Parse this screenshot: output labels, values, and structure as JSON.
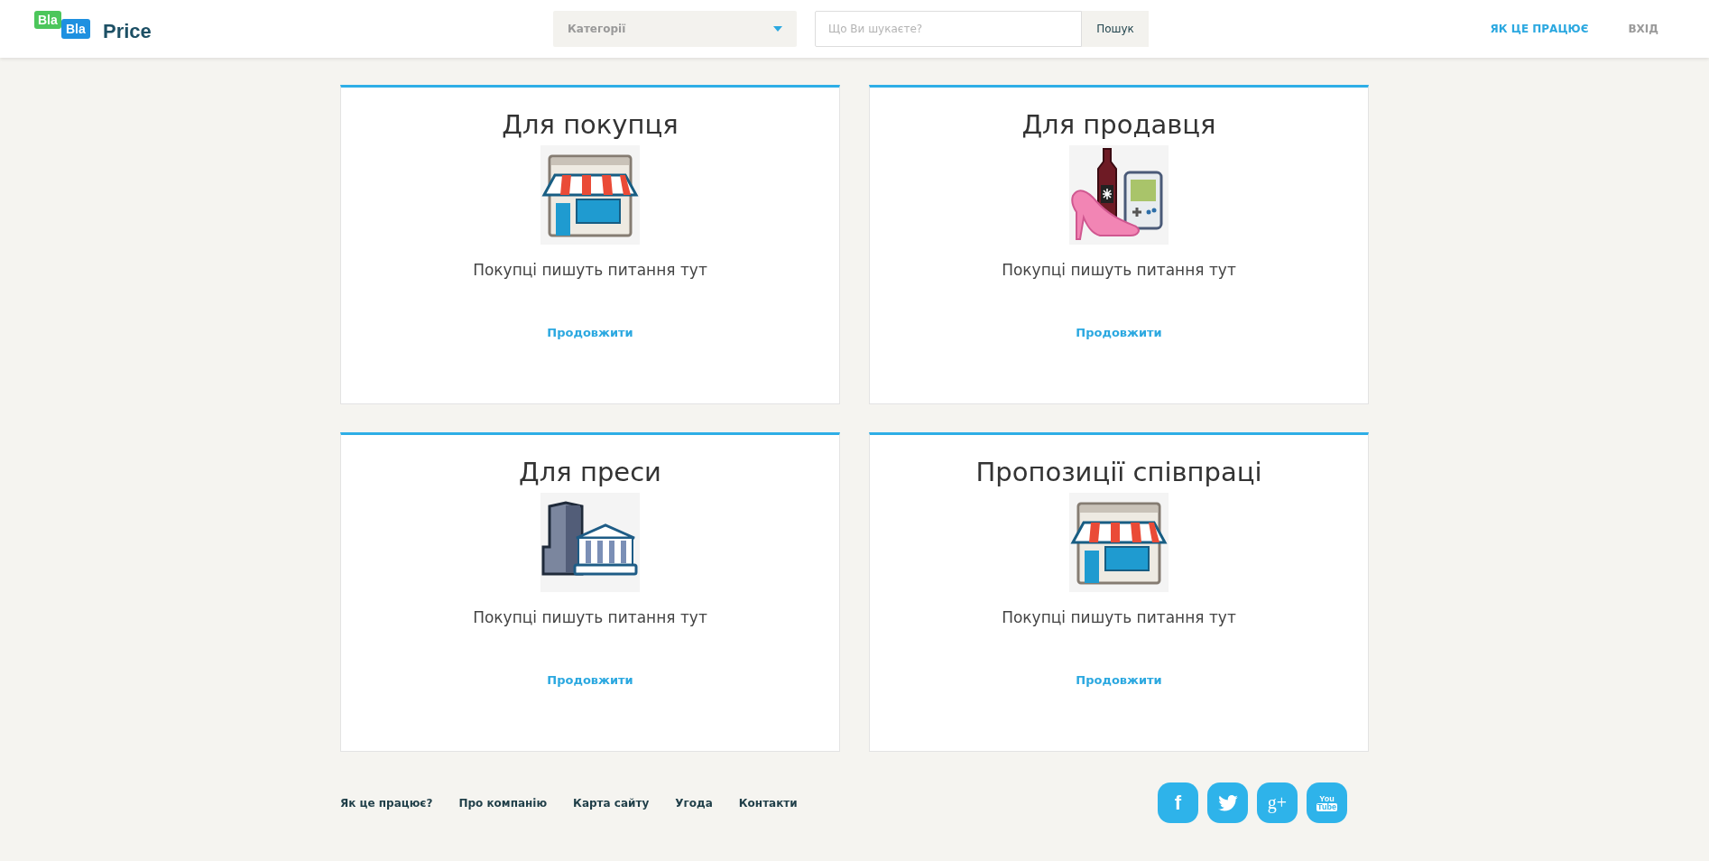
{
  "header": {
    "logo": {
      "word_1": "Bla",
      "word_2": "Bla",
      "word_3": "Price"
    },
    "category_select": {
      "placeholder": "Категорії"
    },
    "search": {
      "placeholder": "Що Ви шукаєте?",
      "button": "Пошук"
    },
    "nav": [
      {
        "label": "ЯК ЦЕ ПРАЦЮЄ",
        "selected": true
      },
      {
        "label": "ВХІД",
        "selected": false
      }
    ]
  },
  "cards": [
    {
      "title": "Для покупця",
      "kind": "store",
      "text": "Покупці пишуть питання тут",
      "link": "Продовжити"
    },
    {
      "title": "Для продавця",
      "kind": "goods",
      "text": "Покупці пишуть питання тут",
      "link": "Продовжити"
    },
    {
      "title": "Для преси",
      "kind": "buildings",
      "text": "Покупці пишуть питання тут",
      "link": "Продовжити"
    },
    {
      "title": "Пропозиції співпраці",
      "kind": "store",
      "text": "Покупці пишуть питання тут",
      "link": "Продовжити"
    }
  ],
  "footer": {
    "links": [
      "Як це працює?",
      "Про компанію",
      "Карта сайту",
      "Угода",
      "Контакти"
    ],
    "social": [
      {
        "kind": "facebook",
        "glyph": "f"
      },
      {
        "kind": "twitter"
      },
      {
        "kind": "google-plus",
        "glyph": "g+"
      },
      {
        "kind": "youtube",
        "glyph": "You",
        "glyph_2": "Tube"
      }
    ]
  }
}
